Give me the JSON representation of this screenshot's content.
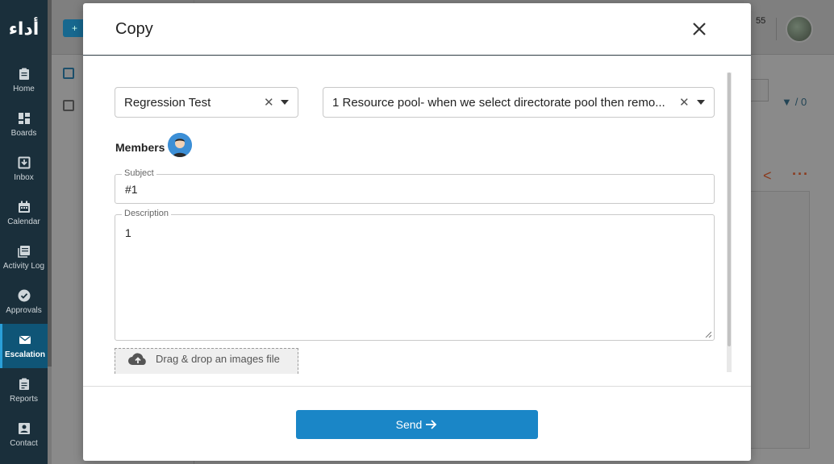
{
  "app": {
    "logo_text": "أداء"
  },
  "sidebar": {
    "items": [
      {
        "label": "Home",
        "icon": "clipboard-icon"
      },
      {
        "label": "Boards",
        "icon": "boards-icon"
      },
      {
        "label": "Inbox",
        "icon": "inbox-icon"
      },
      {
        "label": "Calendar",
        "icon": "calendar-icon"
      },
      {
        "label": "Activity Log",
        "icon": "activity-log-icon"
      },
      {
        "label": "Approvals",
        "icon": "check-circle-icon"
      },
      {
        "label": "Escalation",
        "icon": "mail-icon",
        "active": true
      },
      {
        "label": "Reports",
        "icon": "report-icon"
      },
      {
        "label": "Contact",
        "icon": "contact-icon"
      }
    ]
  },
  "background": {
    "new_button": "+",
    "notifications_count": "55",
    "filter_count": "/ 0"
  },
  "modal": {
    "title": "Copy",
    "project_select": {
      "value": "Regression Test"
    },
    "task_select": {
      "value": "1 Resource pool- when we select directorate pool then remo..."
    },
    "members_label": "Members",
    "subject": {
      "label": "Subject",
      "value": "#1"
    },
    "description": {
      "label": "Description",
      "value": "1"
    },
    "dropzone_text": "Drag & drop an images file",
    "send_label": "Send"
  },
  "colors": {
    "primary": "#1a86c7",
    "sidebar_bg": "#1a2f3b",
    "sidebar_active": "#0f5577"
  }
}
